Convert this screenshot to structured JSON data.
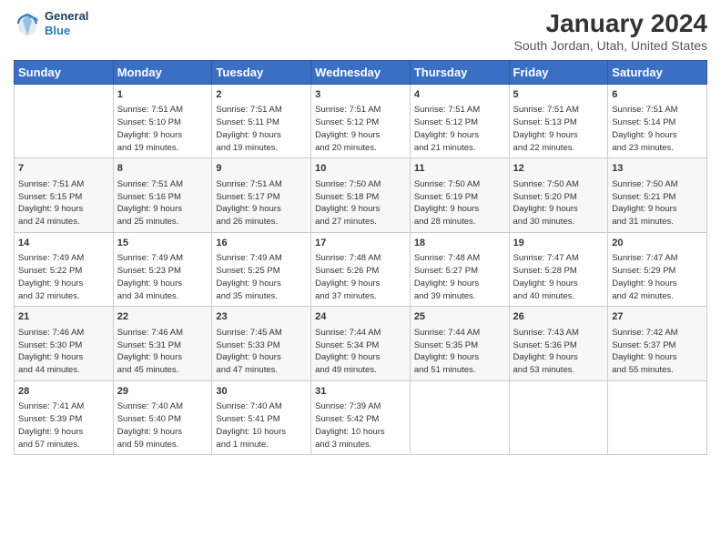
{
  "logo": {
    "general": "General",
    "blue": "Blue"
  },
  "header": {
    "title": "January 2024",
    "location": "South Jordan, Utah, United States"
  },
  "weekdays": [
    "Sunday",
    "Monday",
    "Tuesday",
    "Wednesday",
    "Thursday",
    "Friday",
    "Saturday"
  ],
  "weeks": [
    [
      {
        "day": "",
        "info": ""
      },
      {
        "day": "1",
        "info": "Sunrise: 7:51 AM\nSunset: 5:10 PM\nDaylight: 9 hours\nand 19 minutes."
      },
      {
        "day": "2",
        "info": "Sunrise: 7:51 AM\nSunset: 5:11 PM\nDaylight: 9 hours\nand 19 minutes."
      },
      {
        "day": "3",
        "info": "Sunrise: 7:51 AM\nSunset: 5:12 PM\nDaylight: 9 hours\nand 20 minutes."
      },
      {
        "day": "4",
        "info": "Sunrise: 7:51 AM\nSunset: 5:12 PM\nDaylight: 9 hours\nand 21 minutes."
      },
      {
        "day": "5",
        "info": "Sunrise: 7:51 AM\nSunset: 5:13 PM\nDaylight: 9 hours\nand 22 minutes."
      },
      {
        "day": "6",
        "info": "Sunrise: 7:51 AM\nSunset: 5:14 PM\nDaylight: 9 hours\nand 23 minutes."
      }
    ],
    [
      {
        "day": "7",
        "info": "Sunrise: 7:51 AM\nSunset: 5:15 PM\nDaylight: 9 hours\nand 24 minutes."
      },
      {
        "day": "8",
        "info": "Sunrise: 7:51 AM\nSunset: 5:16 PM\nDaylight: 9 hours\nand 25 minutes."
      },
      {
        "day": "9",
        "info": "Sunrise: 7:51 AM\nSunset: 5:17 PM\nDaylight: 9 hours\nand 26 minutes."
      },
      {
        "day": "10",
        "info": "Sunrise: 7:50 AM\nSunset: 5:18 PM\nDaylight: 9 hours\nand 27 minutes."
      },
      {
        "day": "11",
        "info": "Sunrise: 7:50 AM\nSunset: 5:19 PM\nDaylight: 9 hours\nand 28 minutes."
      },
      {
        "day": "12",
        "info": "Sunrise: 7:50 AM\nSunset: 5:20 PM\nDaylight: 9 hours\nand 30 minutes."
      },
      {
        "day": "13",
        "info": "Sunrise: 7:50 AM\nSunset: 5:21 PM\nDaylight: 9 hours\nand 31 minutes."
      }
    ],
    [
      {
        "day": "14",
        "info": "Sunrise: 7:49 AM\nSunset: 5:22 PM\nDaylight: 9 hours\nand 32 minutes."
      },
      {
        "day": "15",
        "info": "Sunrise: 7:49 AM\nSunset: 5:23 PM\nDaylight: 9 hours\nand 34 minutes."
      },
      {
        "day": "16",
        "info": "Sunrise: 7:49 AM\nSunset: 5:25 PM\nDaylight: 9 hours\nand 35 minutes."
      },
      {
        "day": "17",
        "info": "Sunrise: 7:48 AM\nSunset: 5:26 PM\nDaylight: 9 hours\nand 37 minutes."
      },
      {
        "day": "18",
        "info": "Sunrise: 7:48 AM\nSunset: 5:27 PM\nDaylight: 9 hours\nand 39 minutes."
      },
      {
        "day": "19",
        "info": "Sunrise: 7:47 AM\nSunset: 5:28 PM\nDaylight: 9 hours\nand 40 minutes."
      },
      {
        "day": "20",
        "info": "Sunrise: 7:47 AM\nSunset: 5:29 PM\nDaylight: 9 hours\nand 42 minutes."
      }
    ],
    [
      {
        "day": "21",
        "info": "Sunrise: 7:46 AM\nSunset: 5:30 PM\nDaylight: 9 hours\nand 44 minutes."
      },
      {
        "day": "22",
        "info": "Sunrise: 7:46 AM\nSunset: 5:31 PM\nDaylight: 9 hours\nand 45 minutes."
      },
      {
        "day": "23",
        "info": "Sunrise: 7:45 AM\nSunset: 5:33 PM\nDaylight: 9 hours\nand 47 minutes."
      },
      {
        "day": "24",
        "info": "Sunrise: 7:44 AM\nSunset: 5:34 PM\nDaylight: 9 hours\nand 49 minutes."
      },
      {
        "day": "25",
        "info": "Sunrise: 7:44 AM\nSunset: 5:35 PM\nDaylight: 9 hours\nand 51 minutes."
      },
      {
        "day": "26",
        "info": "Sunrise: 7:43 AM\nSunset: 5:36 PM\nDaylight: 9 hours\nand 53 minutes."
      },
      {
        "day": "27",
        "info": "Sunrise: 7:42 AM\nSunset: 5:37 PM\nDaylight: 9 hours\nand 55 minutes."
      }
    ],
    [
      {
        "day": "28",
        "info": "Sunrise: 7:41 AM\nSunset: 5:39 PM\nDaylight: 9 hours\nand 57 minutes."
      },
      {
        "day": "29",
        "info": "Sunrise: 7:40 AM\nSunset: 5:40 PM\nDaylight: 9 hours\nand 59 minutes."
      },
      {
        "day": "30",
        "info": "Sunrise: 7:40 AM\nSunset: 5:41 PM\nDaylight: 10 hours\nand 1 minute."
      },
      {
        "day": "31",
        "info": "Sunrise: 7:39 AM\nSunset: 5:42 PM\nDaylight: 10 hours\nand 3 minutes."
      },
      {
        "day": "",
        "info": ""
      },
      {
        "day": "",
        "info": ""
      },
      {
        "day": "",
        "info": ""
      }
    ]
  ]
}
